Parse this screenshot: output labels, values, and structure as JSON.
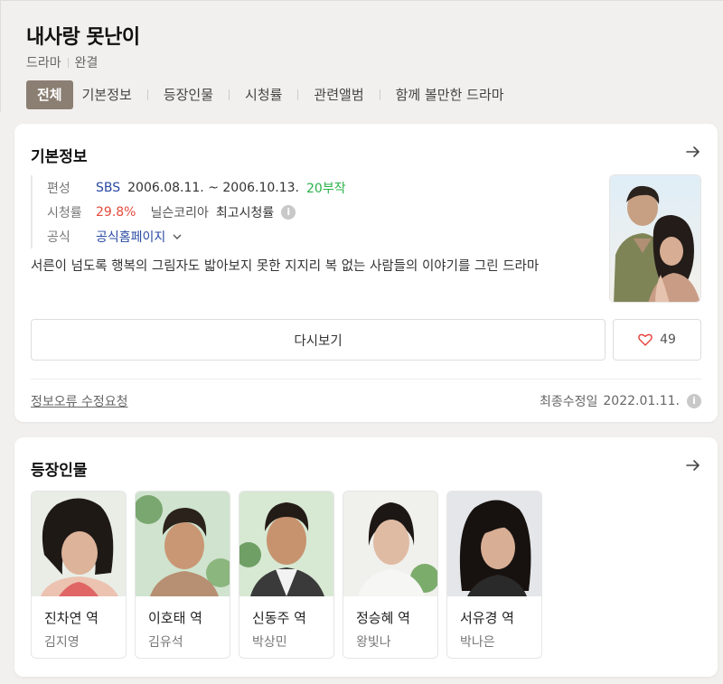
{
  "show": {
    "title": "내사랑 못난이",
    "genre": "드라마",
    "status": "완결"
  },
  "tabs": [
    "전체",
    "기본정보",
    "등장인물",
    "시청률",
    "관련앨범",
    "함께 볼만한 드라마"
  ],
  "basic_info": {
    "title": "기본정보",
    "broadcast_label": "편성",
    "channel": "SBS",
    "period": "2006.08.11. ~ 2006.10.13.",
    "episodes": "20부작",
    "rating_label": "시청률",
    "rating": "29.8%",
    "rating_source": "닐슨코리아",
    "rating_note": "최고시청률",
    "official_label": "공식",
    "official_link": "공식홈페이지",
    "description": "서른이 넘도록 행복의 그림자도 밟아보지 못한 지지리 복 없는 사람들의 이야기를 그린 드라마",
    "replay_button": "다시보기",
    "likes": "49",
    "edit_request": "정보오류 수정요청",
    "updated_label": "최종수정일",
    "updated_date": "2022.01.11."
  },
  "cast_section": {
    "title": "등장인물",
    "members": [
      {
        "role": "진차연 역",
        "actor": "김지영"
      },
      {
        "role": "이호태 역",
        "actor": "김유석"
      },
      {
        "role": "신동주 역",
        "actor": "박상민"
      },
      {
        "role": "정승혜 역",
        "actor": "왕빛나"
      },
      {
        "role": "서유경 역",
        "actor": "박나은"
      }
    ]
  },
  "colors": {
    "accent_tab": "#8b7f73",
    "link_blue": "#2a4aa4",
    "rating_red": "#e54a3c",
    "episodes_green": "#2ab24a"
  }
}
